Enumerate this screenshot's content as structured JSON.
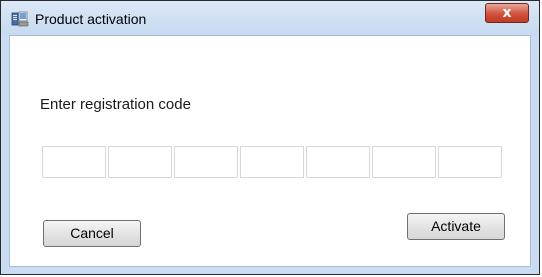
{
  "window": {
    "title": "Product activation",
    "close_label": "x"
  },
  "form": {
    "prompt": "Enter registration code",
    "code_segments": [
      "",
      "",
      "",
      "",
      "",
      "",
      ""
    ]
  },
  "buttons": {
    "cancel": "Cancel",
    "activate": "Activate"
  },
  "colors": {
    "titlebar": "#c6daf0",
    "close_button": "#d1523e",
    "button_face": "#e4e4e4"
  },
  "icons": {
    "app": "product-activation-icon",
    "close": "close-icon"
  }
}
